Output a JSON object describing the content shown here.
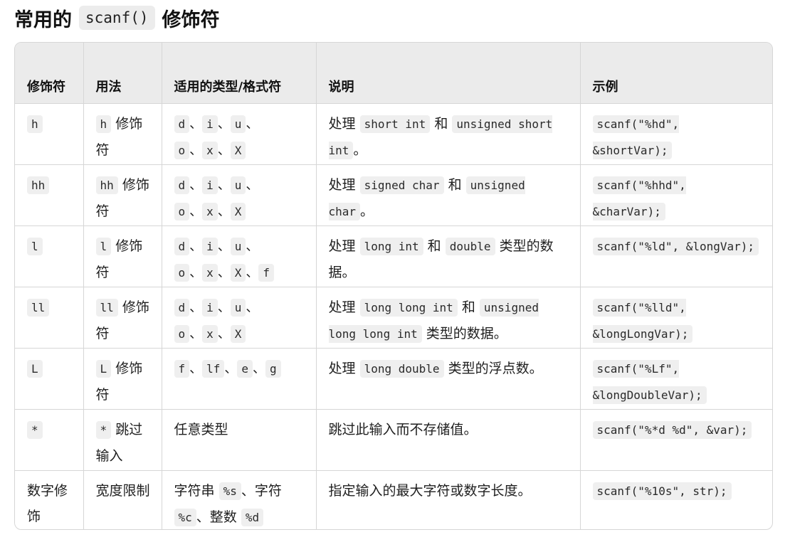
{
  "heading": {
    "prefix": "常用的",
    "code": "scanf()",
    "suffix": "修饰符"
  },
  "table": {
    "columns": [
      "修饰符",
      "用法",
      "适用的类型/格式符",
      "说明",
      "示例"
    ],
    "rows": [
      {
        "modifier": "h",
        "usage_code": "h",
        "usage_text": "修饰符",
        "types": [
          "d",
          "i",
          "u",
          "o",
          "x",
          "X"
        ],
        "desc": [
          "处理",
          "short int",
          "和",
          "unsigned short int",
          "。"
        ],
        "example": "scanf(\"%hd\", &shortVar);"
      },
      {
        "modifier": "hh",
        "usage_code": "hh",
        "usage_text": "修饰符",
        "types": [
          "d",
          "i",
          "u",
          "o",
          "x",
          "X"
        ],
        "desc": [
          "处理",
          "signed char",
          "和",
          "unsigned char",
          "。"
        ],
        "example": "scanf(\"%hhd\", &charVar);"
      },
      {
        "modifier": "l",
        "usage_code": "l",
        "usage_text": "修饰符",
        "types": [
          "d",
          "i",
          "u",
          "o",
          "x",
          "X",
          "f"
        ],
        "desc": [
          "处理",
          "long int",
          "和",
          "double",
          "类型的数据。"
        ],
        "example": "scanf(\"%ld\", &longVar);"
      },
      {
        "modifier": "ll",
        "usage_code": "ll",
        "usage_text": "修饰符",
        "types": [
          "d",
          "i",
          "u",
          "o",
          "x",
          "X"
        ],
        "desc": [
          "处理",
          "long long int",
          "和",
          "unsigned long long int",
          "类型的数据。"
        ],
        "example": "scanf(\"%lld\", &longLongVar);"
      },
      {
        "modifier": "L",
        "usage_code": "L",
        "usage_text": "修饰符",
        "types": [
          "f",
          "lf",
          "e",
          "g"
        ],
        "desc": [
          "处理",
          "long double",
          "类型的浮点数。"
        ],
        "example": "scanf(\"%Lf\", &longDoubleVar);"
      },
      {
        "modifier": "*",
        "usage_code": "*",
        "usage_text": "跳过输入",
        "types_text": "任意类型",
        "desc_text": "跳过此输入而不存储值。",
        "example": "scanf(\"%*d %d\", &var);"
      },
      {
        "modifier_text": "数字修饰",
        "usage_plain": "宽度限制",
        "types_mixed": [
          "字符串",
          "%s",
          "、字符",
          "%c",
          "、整数",
          "%d"
        ],
        "desc_text": "指定输入的最大字符或数字长度。",
        "example": "scanf(\"%10s\", str);"
      }
    ]
  }
}
